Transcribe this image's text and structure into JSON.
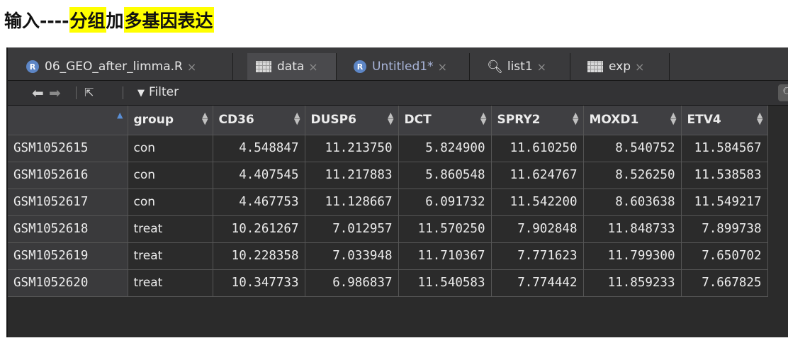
{
  "heading": {
    "parts": [
      {
        "text": "输入----",
        "highlight": false
      },
      {
        "text": "分组",
        "highlight": true
      },
      {
        "text": "加",
        "highlight": false
      },
      {
        "text": "多基因表达",
        "highlight": true
      }
    ],
    "highlight_color": "#ffff00"
  },
  "tabs": [
    {
      "label": "06_GEO_after_limma.R",
      "icon": "r-script-icon",
      "active": false
    },
    {
      "label": "data",
      "icon": "grid-icon",
      "active": true
    },
    {
      "label": "Untitled1*",
      "icon": "r-script-icon",
      "active": false
    },
    {
      "label": "list1",
      "icon": "search-icon",
      "active": false
    },
    {
      "label": "exp",
      "icon": "grid-icon",
      "active": false
    }
  ],
  "toolbar": {
    "filter_label": "Filter"
  },
  "table": {
    "columns": [
      "",
      "group",
      "CD36",
      "DUSP6",
      "DCT",
      "SPRY2",
      "MOXD1",
      "ETV4"
    ],
    "rows": [
      [
        "GSM1052615",
        "con",
        "4.548847",
        "11.213750",
        "5.824900",
        "11.610250",
        "8.540752",
        "11.584567"
      ],
      [
        "GSM1052616",
        "con",
        "4.407545",
        "11.217883",
        "5.860548",
        "11.624767",
        "8.526250",
        "11.538583"
      ],
      [
        "GSM1052617",
        "con",
        "4.467753",
        "11.128667",
        "6.091732",
        "11.542200",
        "8.603638",
        "11.549217"
      ],
      [
        "GSM1052618",
        "treat",
        "10.261267",
        "7.012957",
        "11.570250",
        "7.902848",
        "11.848733",
        "7.899738"
      ],
      [
        "GSM1052619",
        "treat",
        "10.228358",
        "7.033948",
        "11.710367",
        "7.771623",
        "11.799300",
        "7.650702"
      ],
      [
        "GSM1052620",
        "treat",
        "10.347733",
        "6.986837",
        "11.540583",
        "7.774442",
        "11.859233",
        "7.667825"
      ]
    ]
  }
}
